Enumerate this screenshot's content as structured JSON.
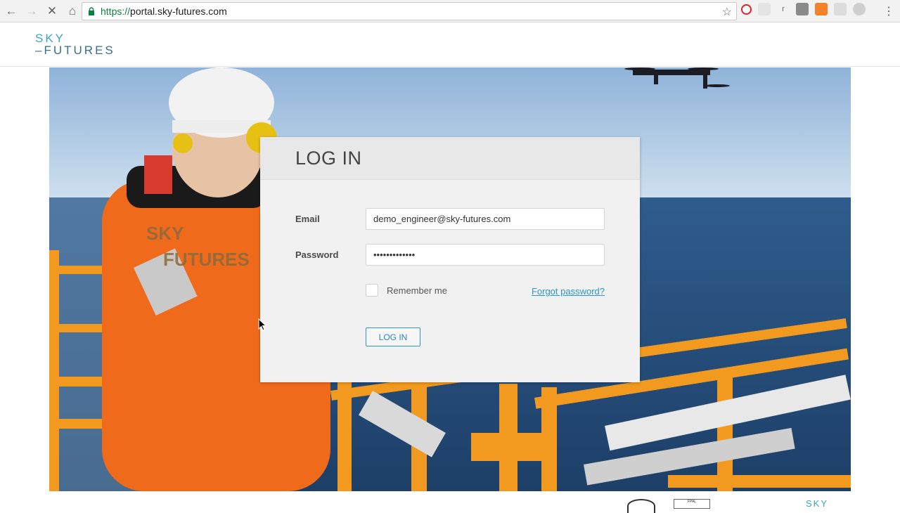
{
  "browser": {
    "url_scheme": "https://",
    "url_host": "portal.sky-futures.com"
  },
  "site": {
    "logo_line1": "SKY",
    "logo_line2": "FUTURES"
  },
  "hero": {
    "vest_text_1": "SKY",
    "vest_text_2": "FUTURES"
  },
  "login": {
    "title": "LOG IN",
    "email_label": "Email",
    "email_value": "demo_engineer@sky-futures.com",
    "password_label": "Password",
    "password_value": "•••••••••••••",
    "remember_label": "Remember me",
    "forgot_label": "Forgot password?",
    "submit_label": "LOG IN"
  },
  "footer": {
    "badge2_text": "FPAL",
    "logo_text": "SKY"
  },
  "colors": {
    "accent": "#2b98c9",
    "logo_light": "#3ba3c5",
    "logo_dark": "#3a6e8a",
    "railing": "#f29a1f",
    "coverall": "#f06a1c"
  },
  "icons": [
    "back-icon",
    "forward-icon",
    "stop-icon",
    "home-icon",
    "lock-icon",
    "star-icon",
    "menu-icon"
  ]
}
